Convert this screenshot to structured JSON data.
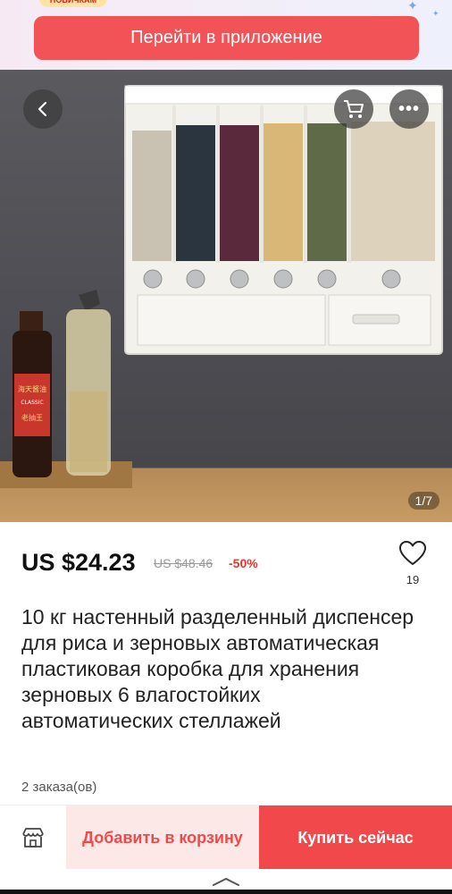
{
  "banner": {
    "promo_tag": "НОВИЧКАМ",
    "open_app_label": "Перейти в приложение"
  },
  "gallery": {
    "counter": "1/7",
    "bottle_labels": [
      "海天酱油",
      "CLASSIC",
      "老抽王"
    ]
  },
  "price": {
    "current": "US $24.23",
    "old": "US $48.46",
    "discount": "-50%"
  },
  "wishlist": {
    "count": "19"
  },
  "product": {
    "title": "10 кг настенный разделенный диспенсер для риса и зерновых автоматическая пластиковая коробка для хранения зерновых 6 влагостойких автоматических стеллажей",
    "orders": "2 заказа(ов)"
  },
  "actions": {
    "add_to_cart": "Добавить в корзину",
    "buy_now": "Купить сейчас"
  },
  "colors": {
    "accent": "#f25356",
    "add_to_cart_bg": "#fde8e8",
    "discount": "#e6352b"
  },
  "icons": {
    "back": "chevron-left-icon",
    "cart": "cart-icon",
    "more": "more-icon",
    "wishlist": "heart-icon",
    "store": "store-icon",
    "nav": "chevron-up-icon"
  }
}
